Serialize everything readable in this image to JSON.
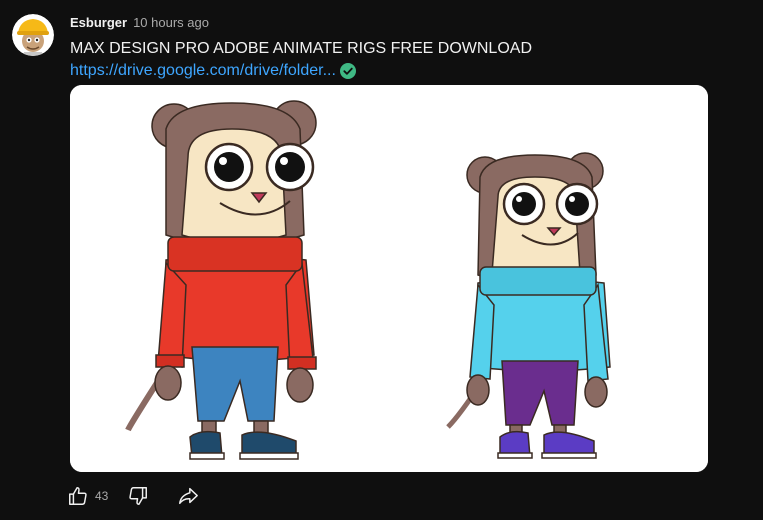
{
  "post": {
    "author": "Esburger",
    "time": "10 hours ago",
    "title": "MAX DESIGN PRO ADOBE ANIMATE RIGS FREE DOWNLOAD",
    "link": "https://drive.google.com/drive/folder...",
    "link_icon": "verified-check-icon",
    "image_description_colors": {
      "background": "#ffffff",
      "left_sweater": "#e8392a",
      "left_pants": "#3d84c0",
      "left_shoes": "#1f4a6b",
      "right_sweater": "#55d1ec",
      "right_pants": "#6a2d8e",
      "right_shoes": "#5b3cc4"
    }
  },
  "actions": {
    "like_icon": "thumbs-up-icon",
    "like_count": "43",
    "dislike_icon": "thumbs-down-icon",
    "share_icon": "share-icon"
  },
  "theme": {
    "background": "#0f0f0f",
    "text": "#f1f1f1",
    "secondary_text": "#aaaaaa",
    "link": "#3ea6ff"
  }
}
